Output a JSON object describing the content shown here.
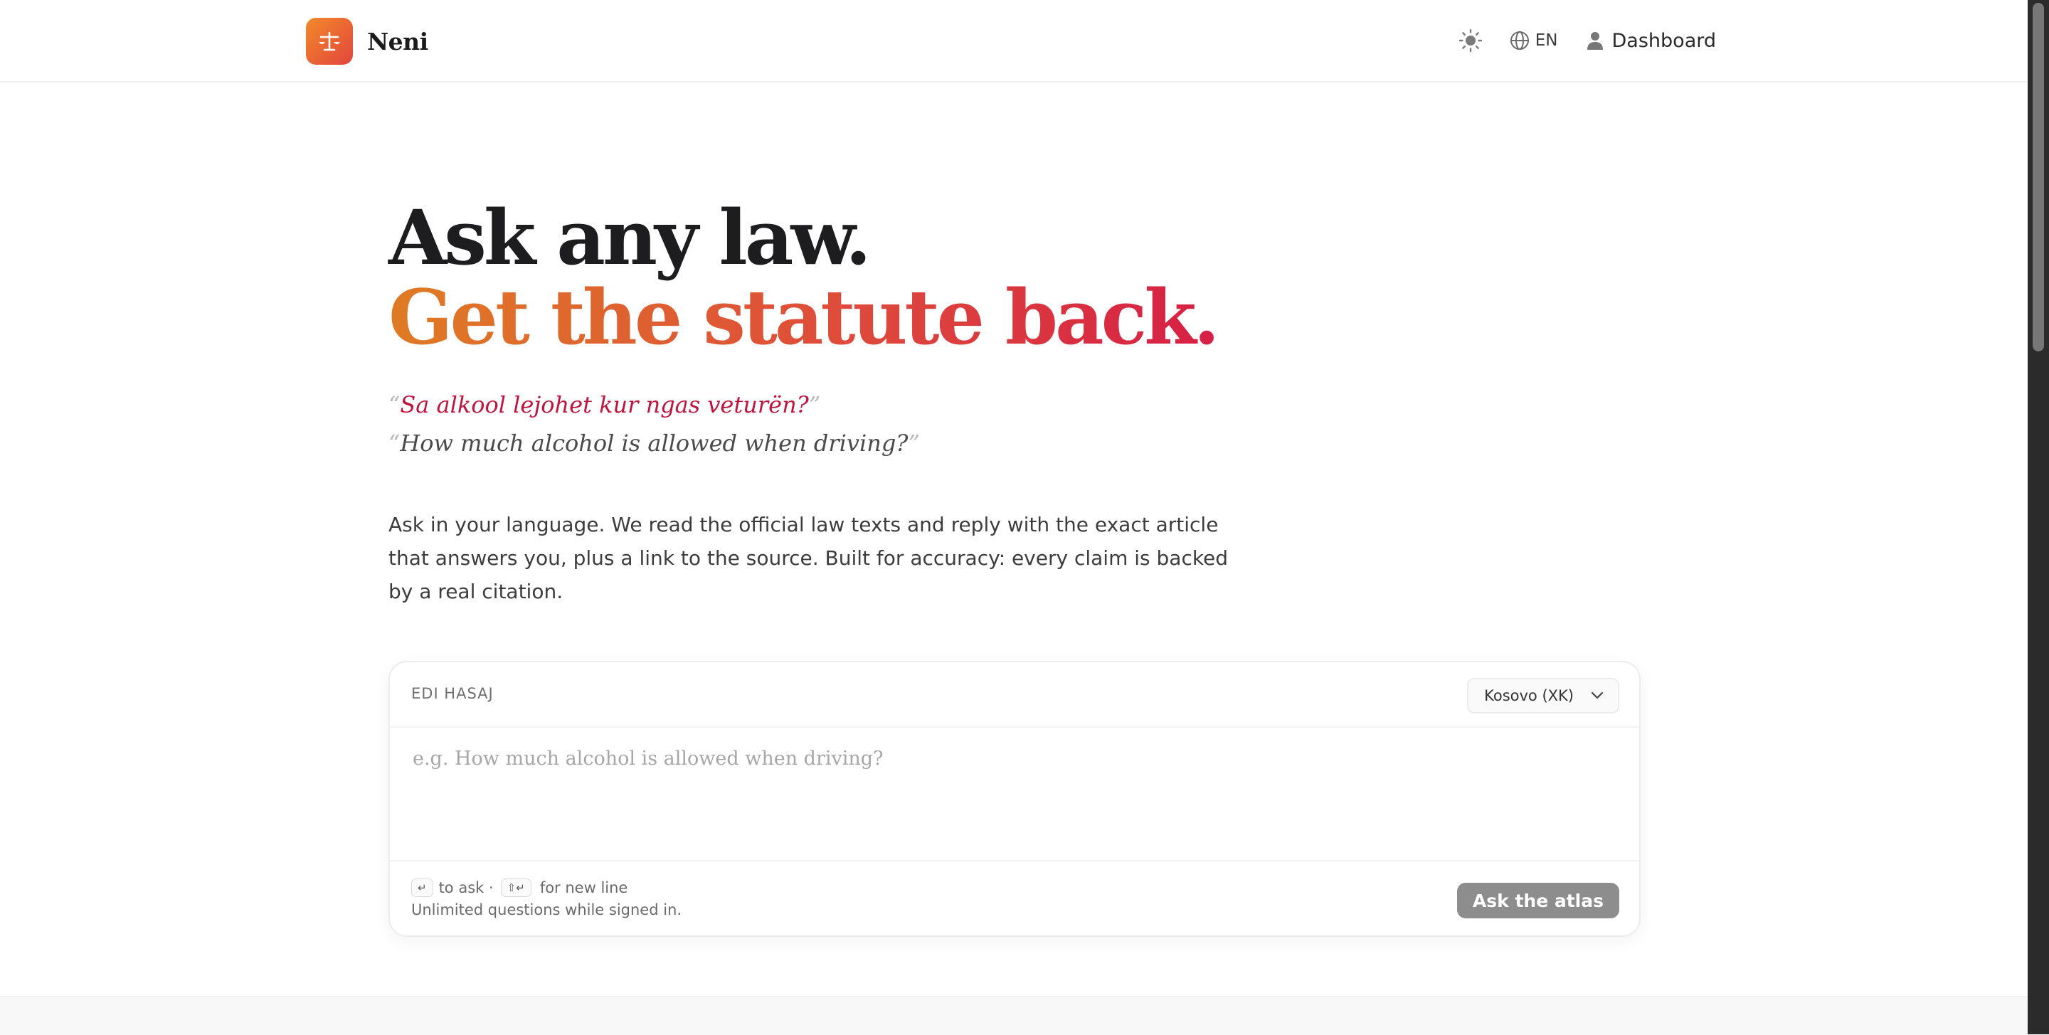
{
  "brand": {
    "name": "Neni"
  },
  "nav": {
    "language": "EN",
    "dashboard": "Dashboard"
  },
  "hero": {
    "headline_1": "Ask any law.",
    "headline_2": "Get the statute back.",
    "quote_albanian": "Sa alkool lejohet kur ngas veturën?",
    "quote_english": "How much alcohol is allowed when driving?",
    "open_quote": "“",
    "close_quote": "”",
    "lead": "Ask in your language. We read the official law texts and reply with the exact article that answers you, plus a link to the source. Built for accuracy: every claim is backed by a real citation."
  },
  "ask": {
    "user": "EDI HASAJ",
    "country": "Kosovo (XK)",
    "placeholder": "e.g. How much alcohol is allowed when driving?",
    "value": "",
    "enter_key": "↵",
    "enter_hint": "to ask ·",
    "shift_key": "⇧↵",
    "shift_hint": "for new line",
    "limits": "Unlimited questions while signed in.",
    "submit": "Ask the atlas"
  },
  "colors": {
    "accent_orange": "#df7b24",
    "accent_red": "#d61f45",
    "quote_red": "#c0143c",
    "button_disabled": "#8d8d8d"
  },
  "icons": {
    "logo": "scales-icon",
    "theme": "sun-icon",
    "language": "globe-icon",
    "account": "user-icon",
    "select": "chevron-down-icon"
  }
}
